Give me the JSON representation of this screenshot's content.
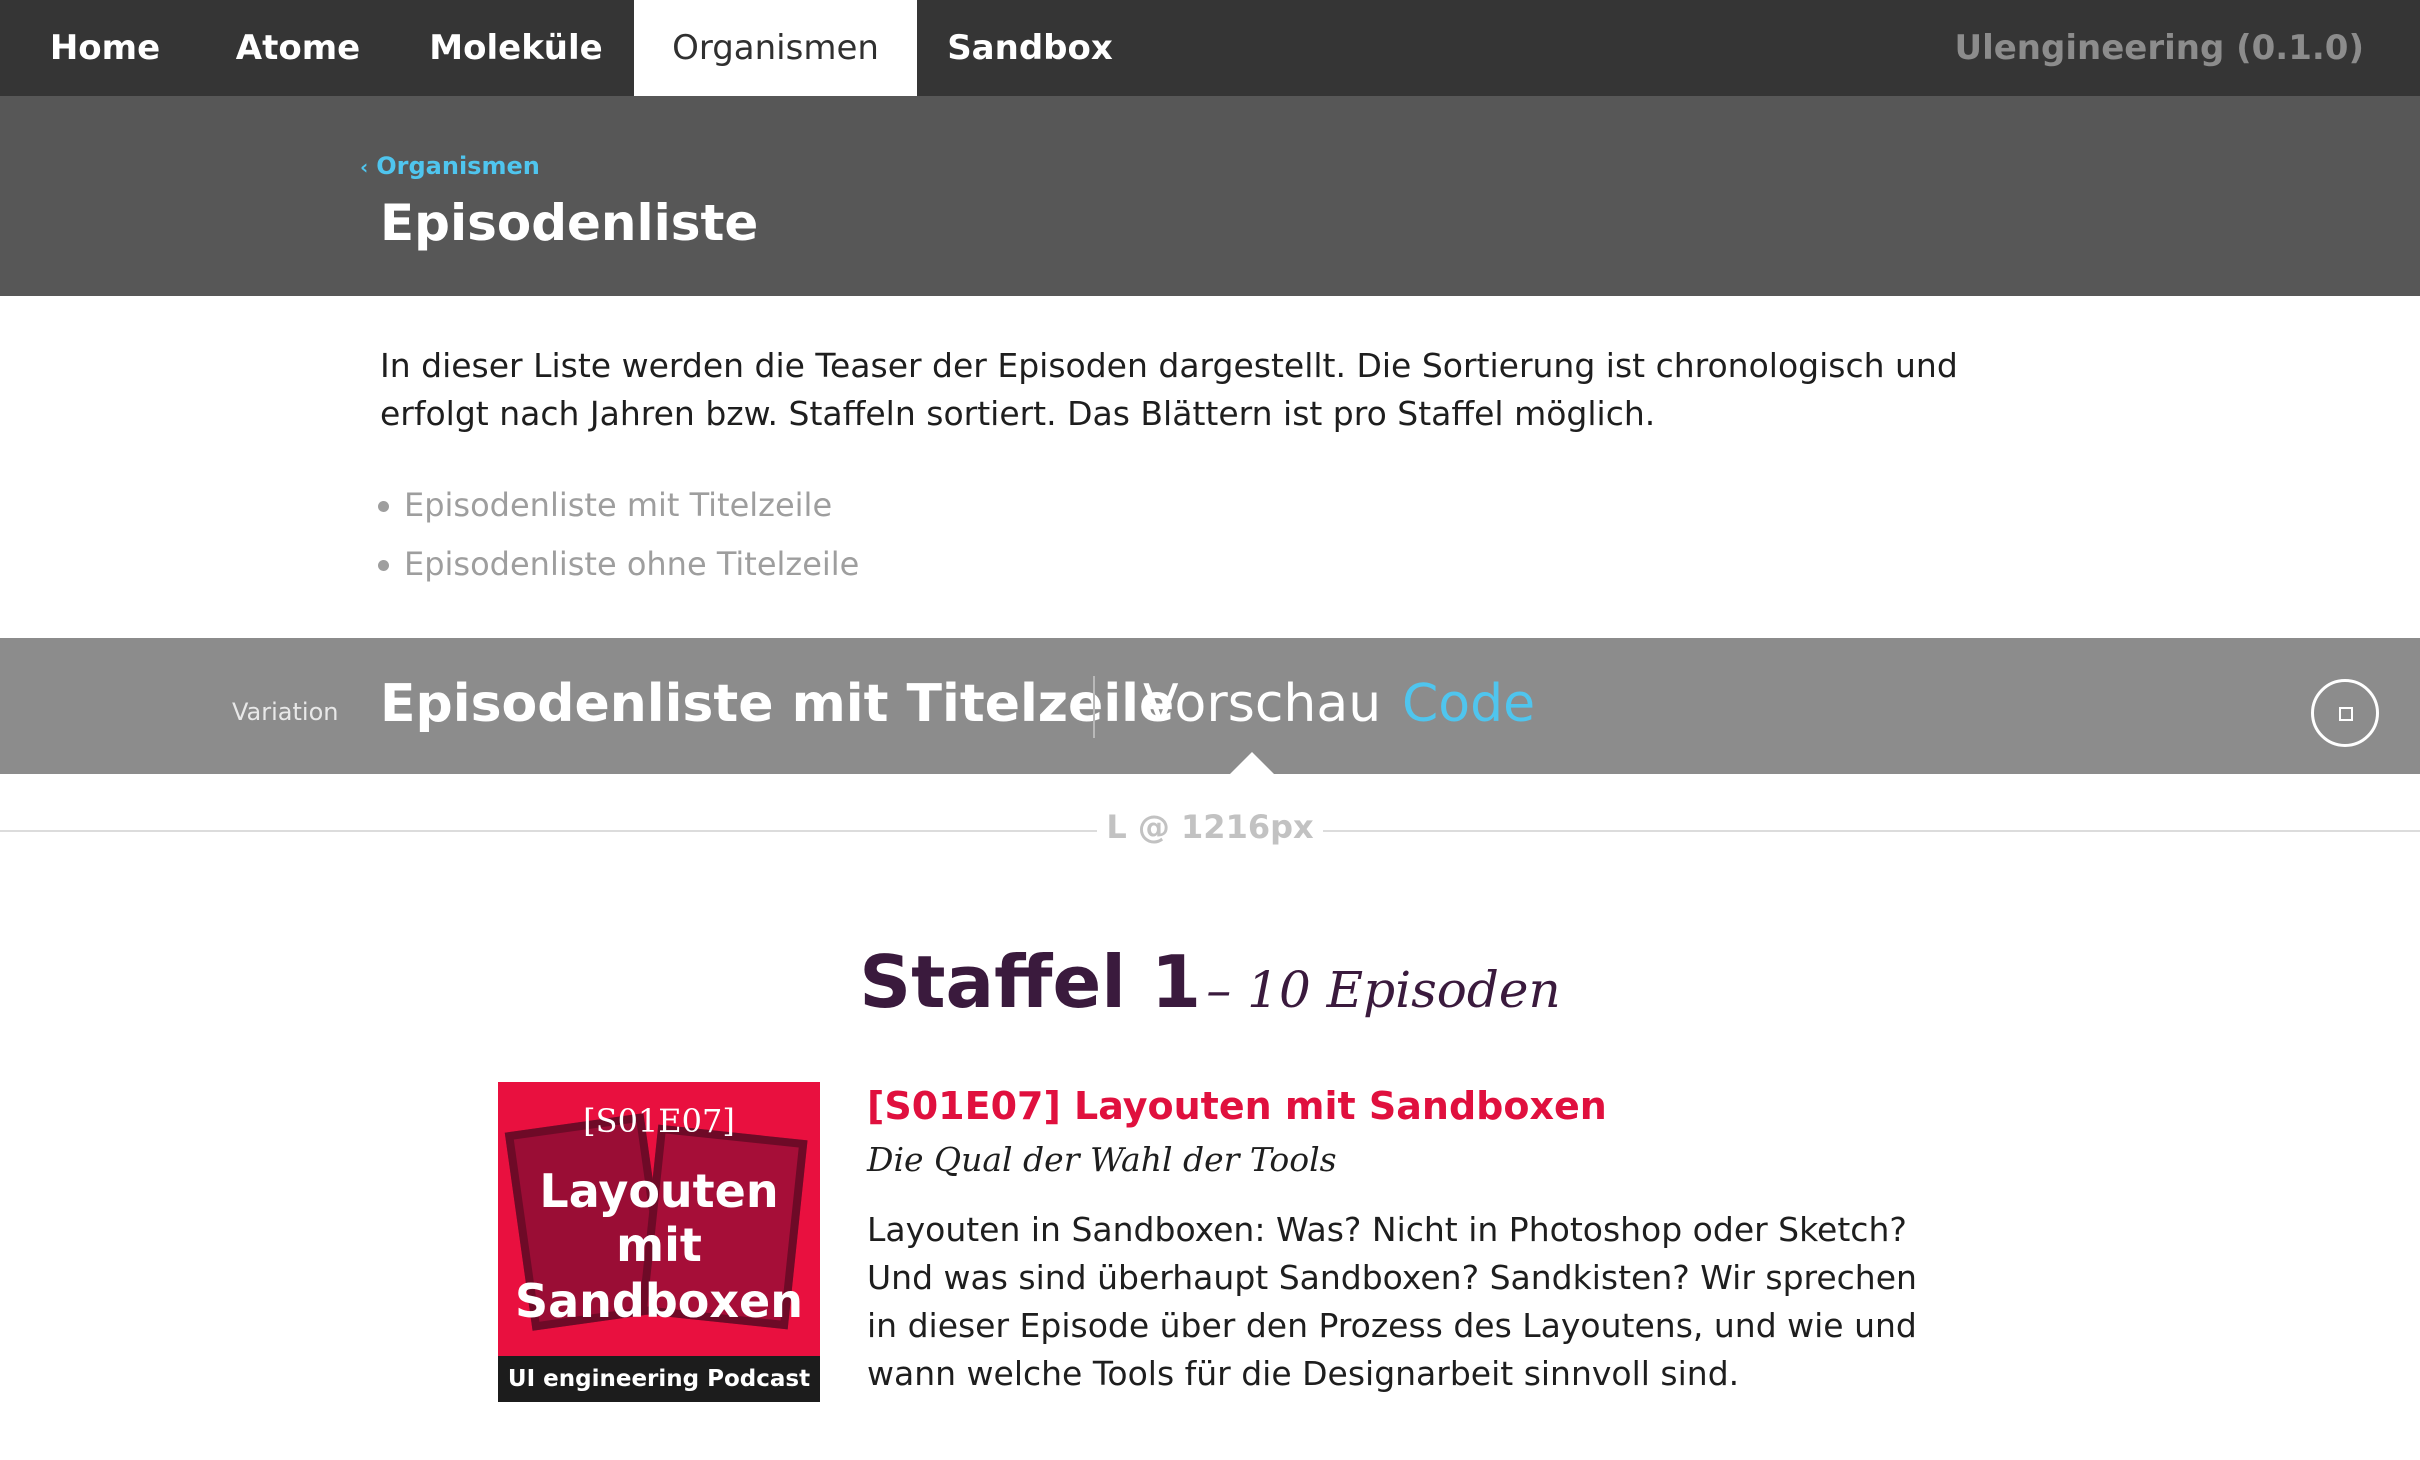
{
  "nav": {
    "items": [
      {
        "label": "Home"
      },
      {
        "label": "Atome"
      },
      {
        "label": "Moleküle"
      },
      {
        "label": "Organismen"
      },
      {
        "label": "Sandbox"
      }
    ],
    "active": "Organismen",
    "brand": "Ulengineering (0.1.0)"
  },
  "header": {
    "breadcrumb": "Organismen",
    "title": "Episodenliste"
  },
  "description": "In dieser Liste werden die Teaser der Episoden dargestellt. Die Sortierung ist chronologisch und erfolgt nach Jahren bzw. Staffeln sortiert. Das Blättern ist pro Staffel möglich.",
  "variants": [
    {
      "label": "Episodenliste mit Titelzeile"
    },
    {
      "label": "Episodenliste ohne Titelzeile"
    }
  ],
  "variation": {
    "label": "Variation",
    "title": "Episodenliste mit Titelzeile",
    "tab_preview": "Vorschau",
    "tab_code": "Code",
    "selected_tab": "Vorschau"
  },
  "viewport": "L @ 1216px",
  "preview": {
    "season_title": "Staffel 1",
    "season_sub": "– 10 Episoden",
    "episode": {
      "cover_code": "[S01E07]",
      "cover_lines": [
        "Layouten",
        "mit",
        "Sandboxen"
      ],
      "cover_footer": "UI engineering Podcast",
      "title": "[S01E07] Layouten mit Sandboxen",
      "subtitle": "Die Qual der Wahl der Tools",
      "text": "Layouten in Sandboxen: Was? Nicht in Photoshop oder Sketch? Und was sind überhaupt Sandboxen? Sandkisten? Wir sprechen in dieser Episode über den Prozess des Layoutens, und wie und wann welche Tools für die Designarbeit sinnvoll sind."
    }
  },
  "colors": {
    "nav_bg": "#353535",
    "header_bg": "#575757",
    "variation_bg": "#8c8c8c",
    "accent_blue": "#4fc5ee",
    "accent_red": "#e0103e",
    "season_purple": "#3a1a3d"
  }
}
